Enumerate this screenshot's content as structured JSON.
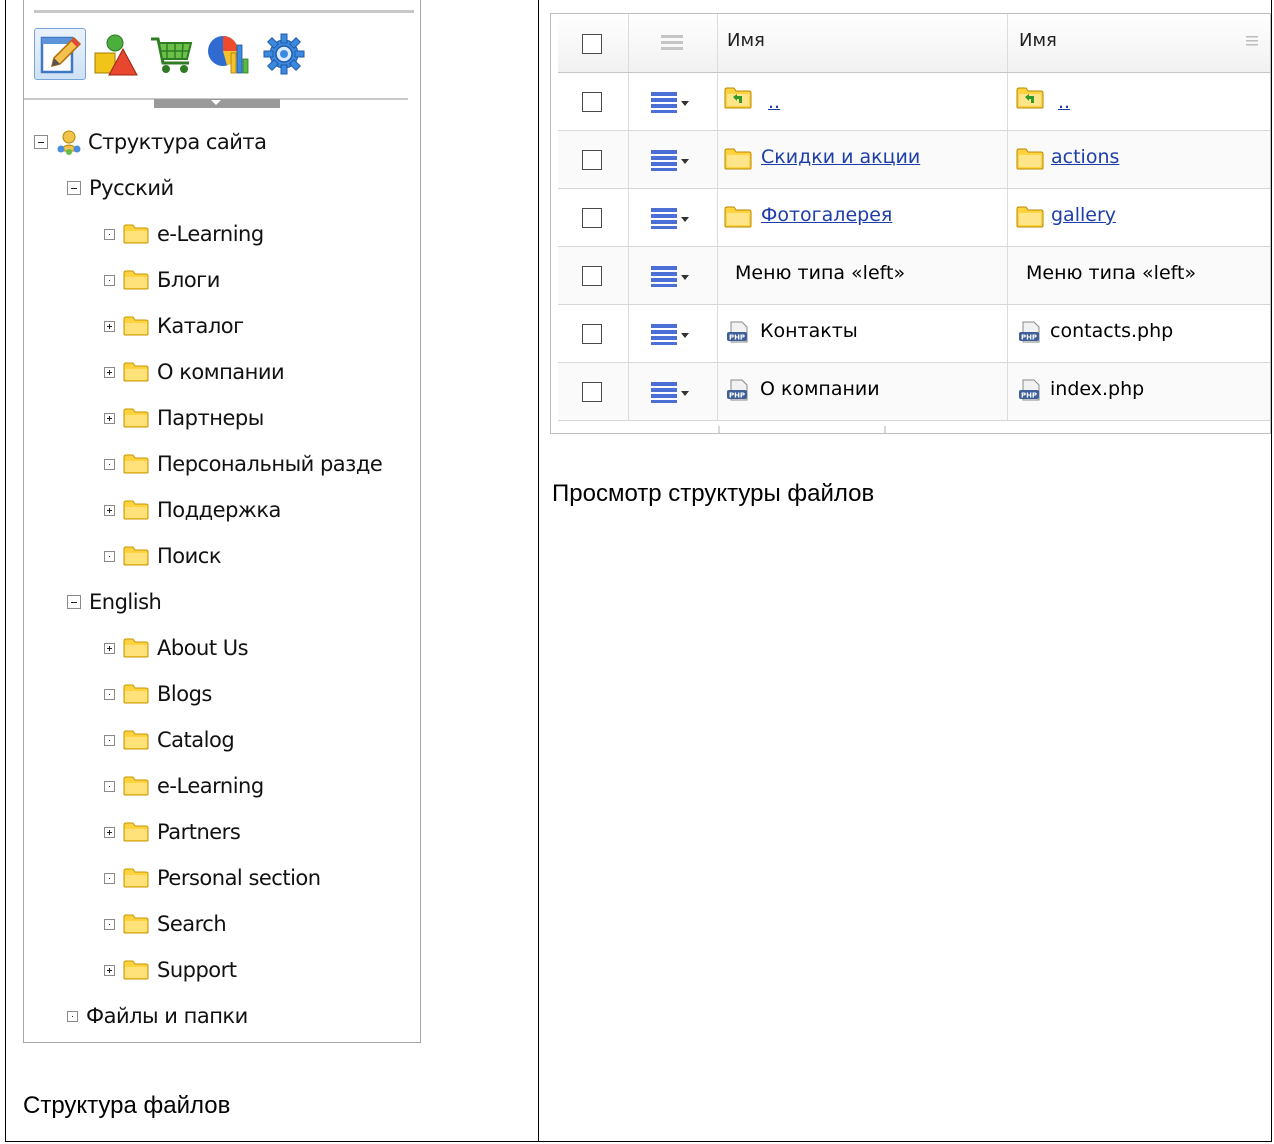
{
  "left_panel": {
    "toolbar": [
      "edit-icon",
      "shapes-icon",
      "cart-icon",
      "chart-icon",
      "settings-icon"
    ],
    "tree": [
      {
        "label": "Структура сайта",
        "expander": "minus"
      },
      {
        "label": "Русский",
        "expander": "minus"
      },
      {
        "label": "e-Learning",
        "expander": "dot"
      },
      {
        "label": "Блоги",
        "expander": "dot"
      },
      {
        "label": "Каталог",
        "expander": "plus"
      },
      {
        "label": "О компании",
        "expander": "plus"
      },
      {
        "label": "Партнеры",
        "expander": "plus"
      },
      {
        "label": "Персональный разде",
        "expander": "dot"
      },
      {
        "label": "Поддержка",
        "expander": "plus"
      },
      {
        "label": "Поиск",
        "expander": "dot"
      },
      {
        "label": "English",
        "expander": "minus"
      },
      {
        "label": "About Us",
        "expander": "plus"
      },
      {
        "label": "Blogs",
        "expander": "dot"
      },
      {
        "label": "Catalog",
        "expander": "dot"
      },
      {
        "label": "e-Learning",
        "expander": "dot"
      },
      {
        "label": "Partners",
        "expander": "plus"
      },
      {
        "label": "Personal section",
        "expander": "dot"
      },
      {
        "label": "Search",
        "expander": "dot"
      },
      {
        "label": "Support",
        "expander": "plus"
      },
      {
        "label": "Файлы и папки",
        "expander": "dot"
      }
    ],
    "caption": "Структура файлов"
  },
  "right_panel": {
    "columns": [
      "Имя",
      "Имя"
    ],
    "rows": [
      {
        "name": "..",
        "file": "..",
        "icon": "folder-up-icon",
        "link": true
      },
      {
        "name": "Скидки и акции",
        "file": "actions",
        "icon": "folder-icon",
        "link": true
      },
      {
        "name": "Фотогалерея",
        "file": "gallery",
        "icon": "folder-icon",
        "link": true
      },
      {
        "name": "Меню типа «left»",
        "file": "Меню типа «left»",
        "icon": "",
        "link": false
      },
      {
        "name": "Контакты",
        "file": "contacts.php",
        "icon": "php-file-icon",
        "link": false
      },
      {
        "name": "О компании",
        "file": "index.php",
        "icon": "php-file-icon",
        "link": false
      }
    ],
    "caption": "Просмотр структуры файлов"
  }
}
